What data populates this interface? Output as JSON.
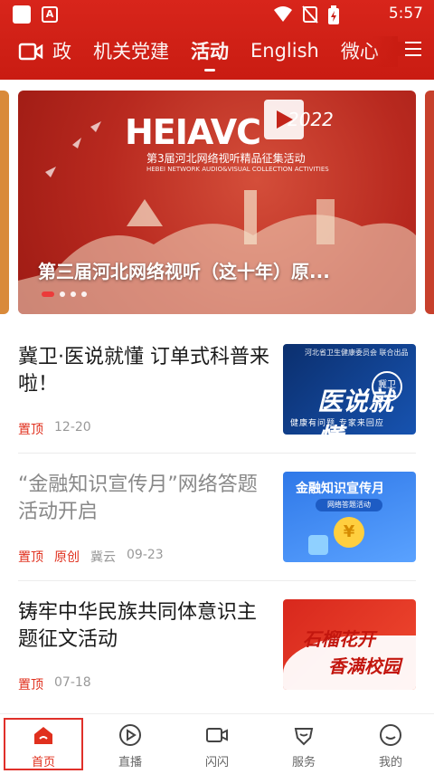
{
  "status_bar": {
    "time": "5:57",
    "notification_badge": "A"
  },
  "nav": {
    "tabs": [
      {
        "label": "政"
      },
      {
        "label": "机关党建"
      },
      {
        "label": "活动"
      },
      {
        "label": "English"
      },
      {
        "label": "微心"
      }
    ],
    "active_tab": "活动"
  },
  "banner": {
    "logo_text": "HEIAVC",
    "year": "2022",
    "subtitle": "第3届河北网络视听精品征集活动",
    "subtitle_en": "HEBEI NETWORK AUDIO&VISUAL COLLECTION ACTIVITIES",
    "caption": "第三届河北网络视听（这十年）原...",
    "dots": 4,
    "active_dot": 0
  },
  "articles": [
    {
      "title": "冀卫·医说就懂 订单式科普来啦！",
      "read": false,
      "tags": [
        "置顶"
      ],
      "source": "",
      "date": "12-20",
      "thumb": {
        "header": "河北省卫生健康委员会 联合出品",
        "main": "医说就懂",
        "badge": "冀卫",
        "bottom": "健康有问题 专家来回应"
      }
    },
    {
      "title": "“金融知识宣传月”网络答题活动开启",
      "read": true,
      "tags": [
        "置顶",
        "原创"
      ],
      "source": "冀云",
      "date": "09-23",
      "thumb": {
        "header": "金融知识宣传月",
        "main": "网络答题活动",
        "coin": "¥"
      }
    },
    {
      "title": "铸牢中华民族共同体意识主题征文活动",
      "read": false,
      "tags": [
        "置顶"
      ],
      "source": "",
      "date": "07-18",
      "thumb": {
        "line1": "石榴花开",
        "line2": "香满校园"
      }
    }
  ],
  "bottom_nav": [
    {
      "label": "首页",
      "icon": "home-icon",
      "active": true
    },
    {
      "label": "直播",
      "icon": "play-circle-icon",
      "active": false
    },
    {
      "label": "闪闪",
      "icon": "video-camera-icon",
      "active": false
    },
    {
      "label": "服务",
      "icon": "service-icon",
      "active": false
    },
    {
      "label": "我的",
      "icon": "smile-face-icon",
      "active": false
    }
  ],
  "colors": {
    "brand_red": "#d8251b",
    "tag_red": "#e0301e",
    "meta_gray": "#999999"
  }
}
